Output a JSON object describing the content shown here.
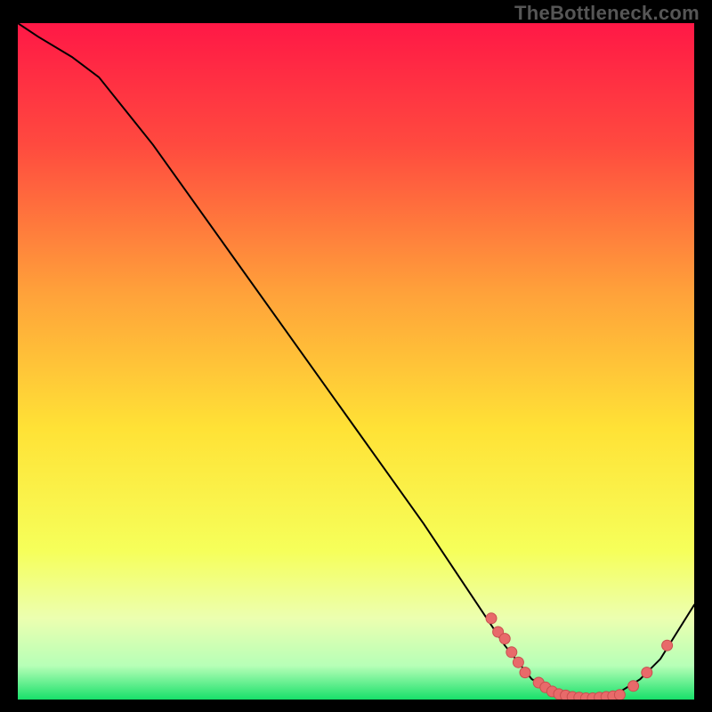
{
  "watermark": "TheBottleneck.com",
  "colors": {
    "gradient": [
      "#ff1846",
      "#ff4a3f",
      "#ffa23a",
      "#ffe236",
      "#f6ff5a",
      "#ecffb0",
      "#b7ffb7",
      "#18e06a"
    ],
    "curve": "#000000",
    "point_fill": "#e86a6a",
    "point_stroke": "#c94f4f"
  },
  "chart_data": {
    "type": "line",
    "title": "",
    "xlabel": "",
    "ylabel": "",
    "xlim": [
      0,
      100
    ],
    "ylim": [
      0,
      100
    ],
    "grid": false,
    "legend": false,
    "curve": [
      {
        "x": 0,
        "y": 100
      },
      {
        "x": 3,
        "y": 98
      },
      {
        "x": 8,
        "y": 95
      },
      {
        "x": 12,
        "y": 92
      },
      {
        "x": 20,
        "y": 82
      },
      {
        "x": 30,
        "y": 68
      },
      {
        "x": 40,
        "y": 54
      },
      {
        "x": 50,
        "y": 40
      },
      {
        "x": 60,
        "y": 26
      },
      {
        "x": 68,
        "y": 14
      },
      {
        "x": 72,
        "y": 8
      },
      {
        "x": 76,
        "y": 3
      },
      {
        "x": 80,
        "y": 1
      },
      {
        "x": 84,
        "y": 0
      },
      {
        "x": 88,
        "y": 0.5
      },
      {
        "x": 92,
        "y": 3
      },
      {
        "x": 95,
        "y": 6
      },
      {
        "x": 100,
        "y": 14
      }
    ],
    "series": [
      {
        "name": "measured-points",
        "points": [
          {
            "x": 70,
            "y": 12
          },
          {
            "x": 71,
            "y": 10
          },
          {
            "x": 72,
            "y": 9
          },
          {
            "x": 73,
            "y": 7
          },
          {
            "x": 74,
            "y": 5.5
          },
          {
            "x": 75,
            "y": 4
          },
          {
            "x": 77,
            "y": 2.5
          },
          {
            "x": 78,
            "y": 1.8
          },
          {
            "x": 79,
            "y": 1.2
          },
          {
            "x": 80,
            "y": 0.8
          },
          {
            "x": 81,
            "y": 0.6
          },
          {
            "x": 82,
            "y": 0.4
          },
          {
            "x": 83,
            "y": 0.3
          },
          {
            "x": 84,
            "y": 0.2
          },
          {
            "x": 85,
            "y": 0.2
          },
          {
            "x": 86,
            "y": 0.3
          },
          {
            "x": 87,
            "y": 0.4
          },
          {
            "x": 88,
            "y": 0.5
          },
          {
            "x": 89,
            "y": 0.7
          },
          {
            "x": 91,
            "y": 2
          },
          {
            "x": 93,
            "y": 4
          },
          {
            "x": 96,
            "y": 8
          }
        ]
      }
    ]
  }
}
